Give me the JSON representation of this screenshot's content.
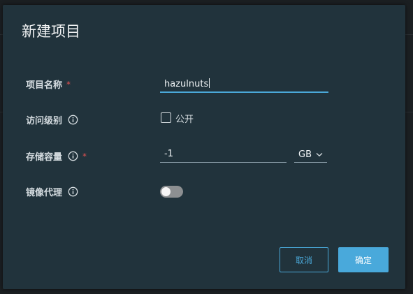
{
  "dialog": {
    "title": "新建项目",
    "fields": {
      "project_name": {
        "label": "项目名称",
        "required_mark": "*",
        "value": "hazulnuts"
      },
      "access_level": {
        "label": "访问级别",
        "checkbox_label": "公开",
        "checked": false
      },
      "storage_quota": {
        "label": "存储容量",
        "required_mark": "*",
        "value": "-1",
        "unit": "GB"
      },
      "mirror_proxy": {
        "label": "镜像代理",
        "enabled": false
      }
    },
    "buttons": {
      "cancel": "取消",
      "confirm": "确定"
    }
  },
  "colors": {
    "accent": "#49a9db",
    "required": "#e05252",
    "dialog_bg": "#21333c"
  },
  "icons": {
    "info": "info-circle-icon",
    "chevron": "chevron-down-icon"
  }
}
